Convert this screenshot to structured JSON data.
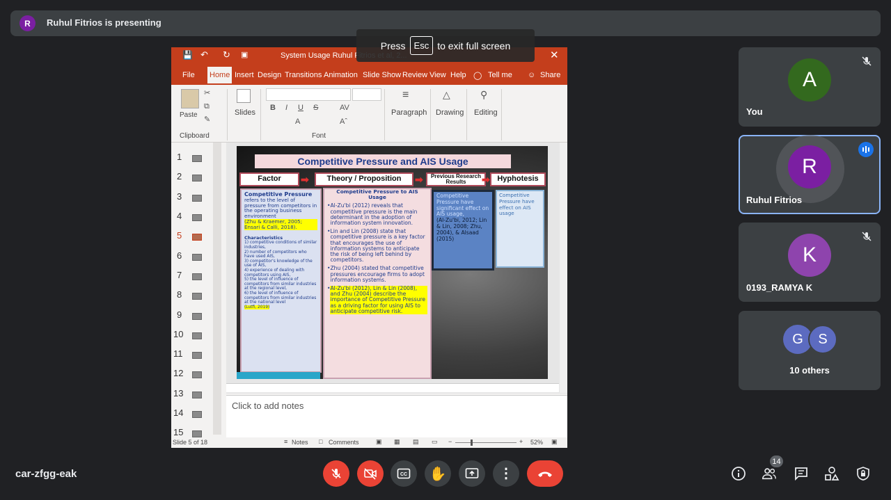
{
  "presenting": {
    "avatar_letter": "R",
    "text": "Ruhul Fitrios is presenting"
  },
  "esc": {
    "press": "Press",
    "key": "Esc",
    "rest": "to exit full screen"
  },
  "ppt": {
    "file_title": "System Usage Ruhul Fitrios et al, 2...",
    "tabs": [
      "File",
      "Home",
      "Insert",
      "Design",
      "Transitions",
      "Animation",
      "Slide Show",
      "Review",
      "View",
      "Help"
    ],
    "tell_me": "Tell me",
    "share": "Share",
    "ribbon": {
      "paste": "Paste",
      "clipboard": "Clipboard",
      "slides": "Slides",
      "font": "Font",
      "paragraph": "Paragraph",
      "drawing": "Drawing",
      "editing": "Editing"
    },
    "thumb_numbers": [
      "1",
      "2",
      "3",
      "4",
      "5",
      "6",
      "7",
      "8",
      "9",
      "10",
      "11",
      "12",
      "13",
      "14",
      "15"
    ],
    "selected_slide": "5",
    "notes_placeholder": "Click to add notes",
    "status": {
      "slide": "Slide 5 of 18",
      "notes": "Notes",
      "comments": "Comments",
      "zoom": "52%"
    }
  },
  "slide": {
    "title": "Competitive Pressure and AIS Usage",
    "headers": [
      "Factor",
      "Theory / Proposition",
      "Previous Research Results",
      "Hyphotesis"
    ],
    "factor": {
      "heading": "Competitive Pressure",
      "body": "refers to the level of pressure from competitors in the operating business environment",
      "cite": "(Zhu & Kraemer, 2005; Ensari & Calli, 2018).",
      "char_heading": "Characteristics",
      "chars": [
        "1) competitive conditions of similar industries,",
        "2) number of competitors who have used AIS,",
        "3) competitor's knowledge of the use of AIS,",
        "4) experience of dealing with competitors using AIS,",
        "5) the level of influence of competitors from similar industries at the regional level,",
        "6) the level of influence of competitors from similar industries at the national level"
      ],
      "char_cite": "(Lutfi, 2019)"
    },
    "theory": {
      "heading": "Competitive Pressure to AIS Usage",
      "bullets": [
        "Al-Zu'bi (2012) reveals that competitive pressure is the main determinant in the adoption of information system innovation.",
        "Lin and Lin (2008) state that competitive pressure is a key factor that encourages the use of information systems to anticipate the risk of being left behind by competitors.",
        "Zhu (2004) stated that competitive pressures encourage firms to adopt information systems."
      ],
      "highlight_bullet": "Al-Zu'bi (2012), Lin & Lin (2008), and Zhu (2004) describe the importance of Competitive Pressure as a driving factor for using AIS to anticipate competitive risk."
    },
    "previous": {
      "text": "Competitive Pressure have significant effect on AIS usage,",
      "cites": "(Al-Zu'bi, 2012; Lin & Lin, 2008; Zhu, 2004), & Alsaad (2015)"
    },
    "hypothesis": "Competitive Pressure have effect on AIS usage"
  },
  "participants": [
    {
      "letter": "A",
      "name": "You",
      "color": "#33691e",
      "muted": true
    },
    {
      "letter": "R",
      "name": "Ruhul Fitrios",
      "color": "#7b1fa2",
      "speaking": true
    },
    {
      "letter": "K",
      "name": "0193_RAMYA K",
      "color": "#8e44ad",
      "muted": true
    }
  ],
  "others": {
    "letters": [
      "G",
      "S"
    ],
    "label": "10 others"
  },
  "meeting_code": "car-zfgg-eak",
  "people_count": "14"
}
